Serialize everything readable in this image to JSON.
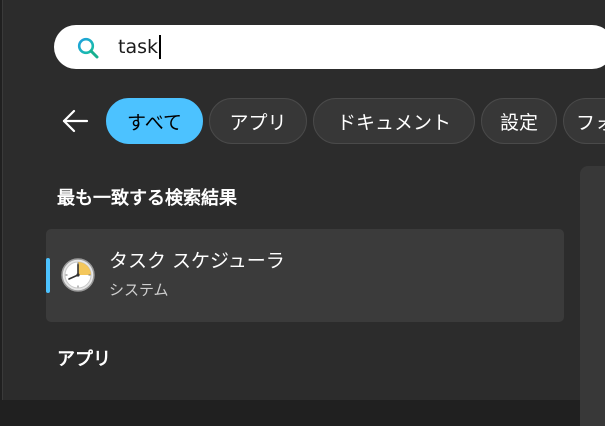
{
  "search": {
    "query": "task"
  },
  "filters": [
    {
      "label": "すべて",
      "active": true
    },
    {
      "label": "アプリ",
      "active": false
    },
    {
      "label": "ドキュメント",
      "active": false
    },
    {
      "label": "設定",
      "active": false
    },
    {
      "label": "フォ",
      "active": false
    }
  ],
  "sections": {
    "best_match_title": "最も一致する検索結果",
    "apps_title": "アプリ"
  },
  "best_match": {
    "name": "タスク スケジューラ",
    "type": "システム",
    "icon": "clock-icon"
  },
  "colors": {
    "accent": "#4cc2ff",
    "panel_bg": "#2c2c2c",
    "selected_bg": "#3b3b3b"
  }
}
